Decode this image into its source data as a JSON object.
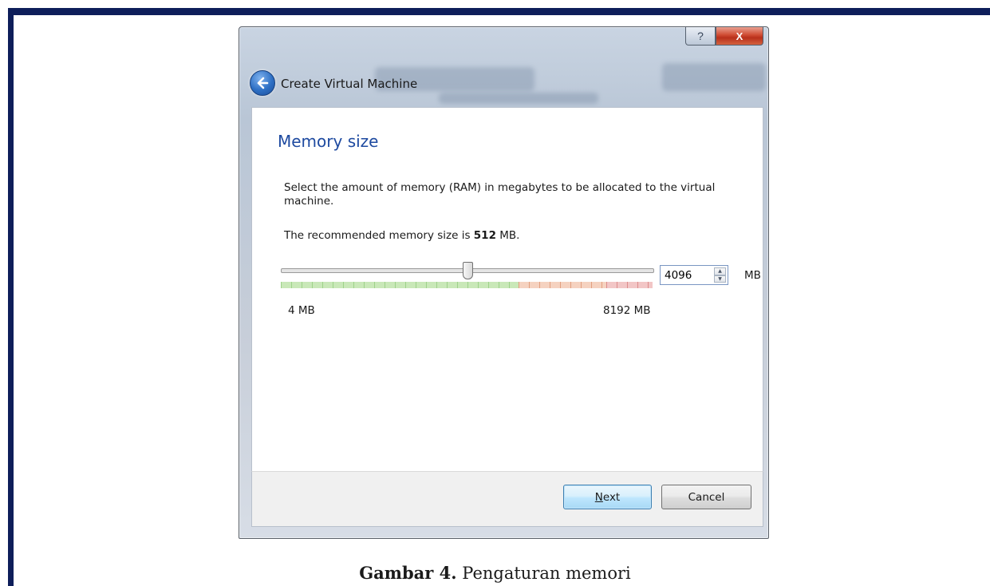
{
  "window": {
    "title": "Create Virtual Machine",
    "help_glyph": "?",
    "close_glyph": "X"
  },
  "page": {
    "heading": "Memory size",
    "description": "Select the amount of memory (RAM) in megabytes to be allocated to the virtual machine.",
    "recommended_prefix": "The recommended memory size is ",
    "recommended_value": "512",
    "recommended_suffix": " MB."
  },
  "memory": {
    "value": "4096",
    "unit": "MB",
    "min_label": "4 MB",
    "max_label": "8192 MB",
    "slider_value_fraction": 0.5
  },
  "buttons": {
    "next": "Next",
    "cancel": "Cancel"
  },
  "caption": {
    "label": "Gambar 4.",
    "text": " Pengaturan memori"
  },
  "colors": {
    "frame": "#0e1e5a",
    "heading": "#1e4aa0",
    "slider_green": "#9ed28a",
    "slider_orange": "#e29f7f",
    "slider_red": "#dc8c8c"
  },
  "icons": {
    "back": "back-arrow-icon",
    "spin_up": "chevron-up-icon",
    "spin_down": "chevron-down-icon"
  }
}
